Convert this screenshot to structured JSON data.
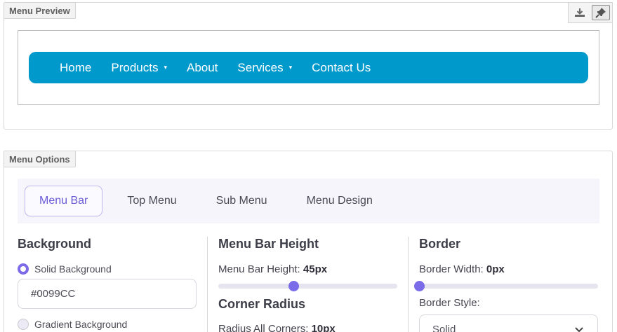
{
  "preview": {
    "legend": "Menu Preview",
    "toolbar": {
      "download_icon": "download-icon",
      "pin_icon": "pin-icon"
    },
    "menu": {
      "background_color": "#0099CC",
      "text_color": "#FFFFFF",
      "items": [
        {
          "label": "Home",
          "has_submenu": false
        },
        {
          "label": "Products",
          "has_submenu": true
        },
        {
          "label": "About",
          "has_submenu": false
        },
        {
          "label": "Services",
          "has_submenu": true
        },
        {
          "label": "Contact Us",
          "has_submenu": false
        }
      ],
      "caret": "▾"
    }
  },
  "options": {
    "legend": "Menu Options",
    "tabs": [
      {
        "label": "Menu Bar",
        "active": true
      },
      {
        "label": "Top Menu",
        "active": false
      },
      {
        "label": "Sub Menu",
        "active": false
      },
      {
        "label": "Menu Design",
        "active": false
      }
    ],
    "background": {
      "title": "Background",
      "solid_label": "Solid Background",
      "solid_selected": true,
      "color_value": "#0099CC",
      "gradient_label": "Gradient Background"
    },
    "height": {
      "title": "Menu Bar Height",
      "label": "Menu Bar Height:",
      "value": "45px",
      "slider_fraction": 0.42,
      "corner_title": "Corner Radius",
      "corner_label": "Radius All Corners:",
      "corner_value": "10px"
    },
    "border": {
      "title": "Border",
      "width_label": "Border Width:",
      "width_value": "0px",
      "slider_fraction": 0.0,
      "style_label": "Border Style:",
      "style_value": "Solid"
    },
    "accent_color": "#7C6AE8"
  }
}
